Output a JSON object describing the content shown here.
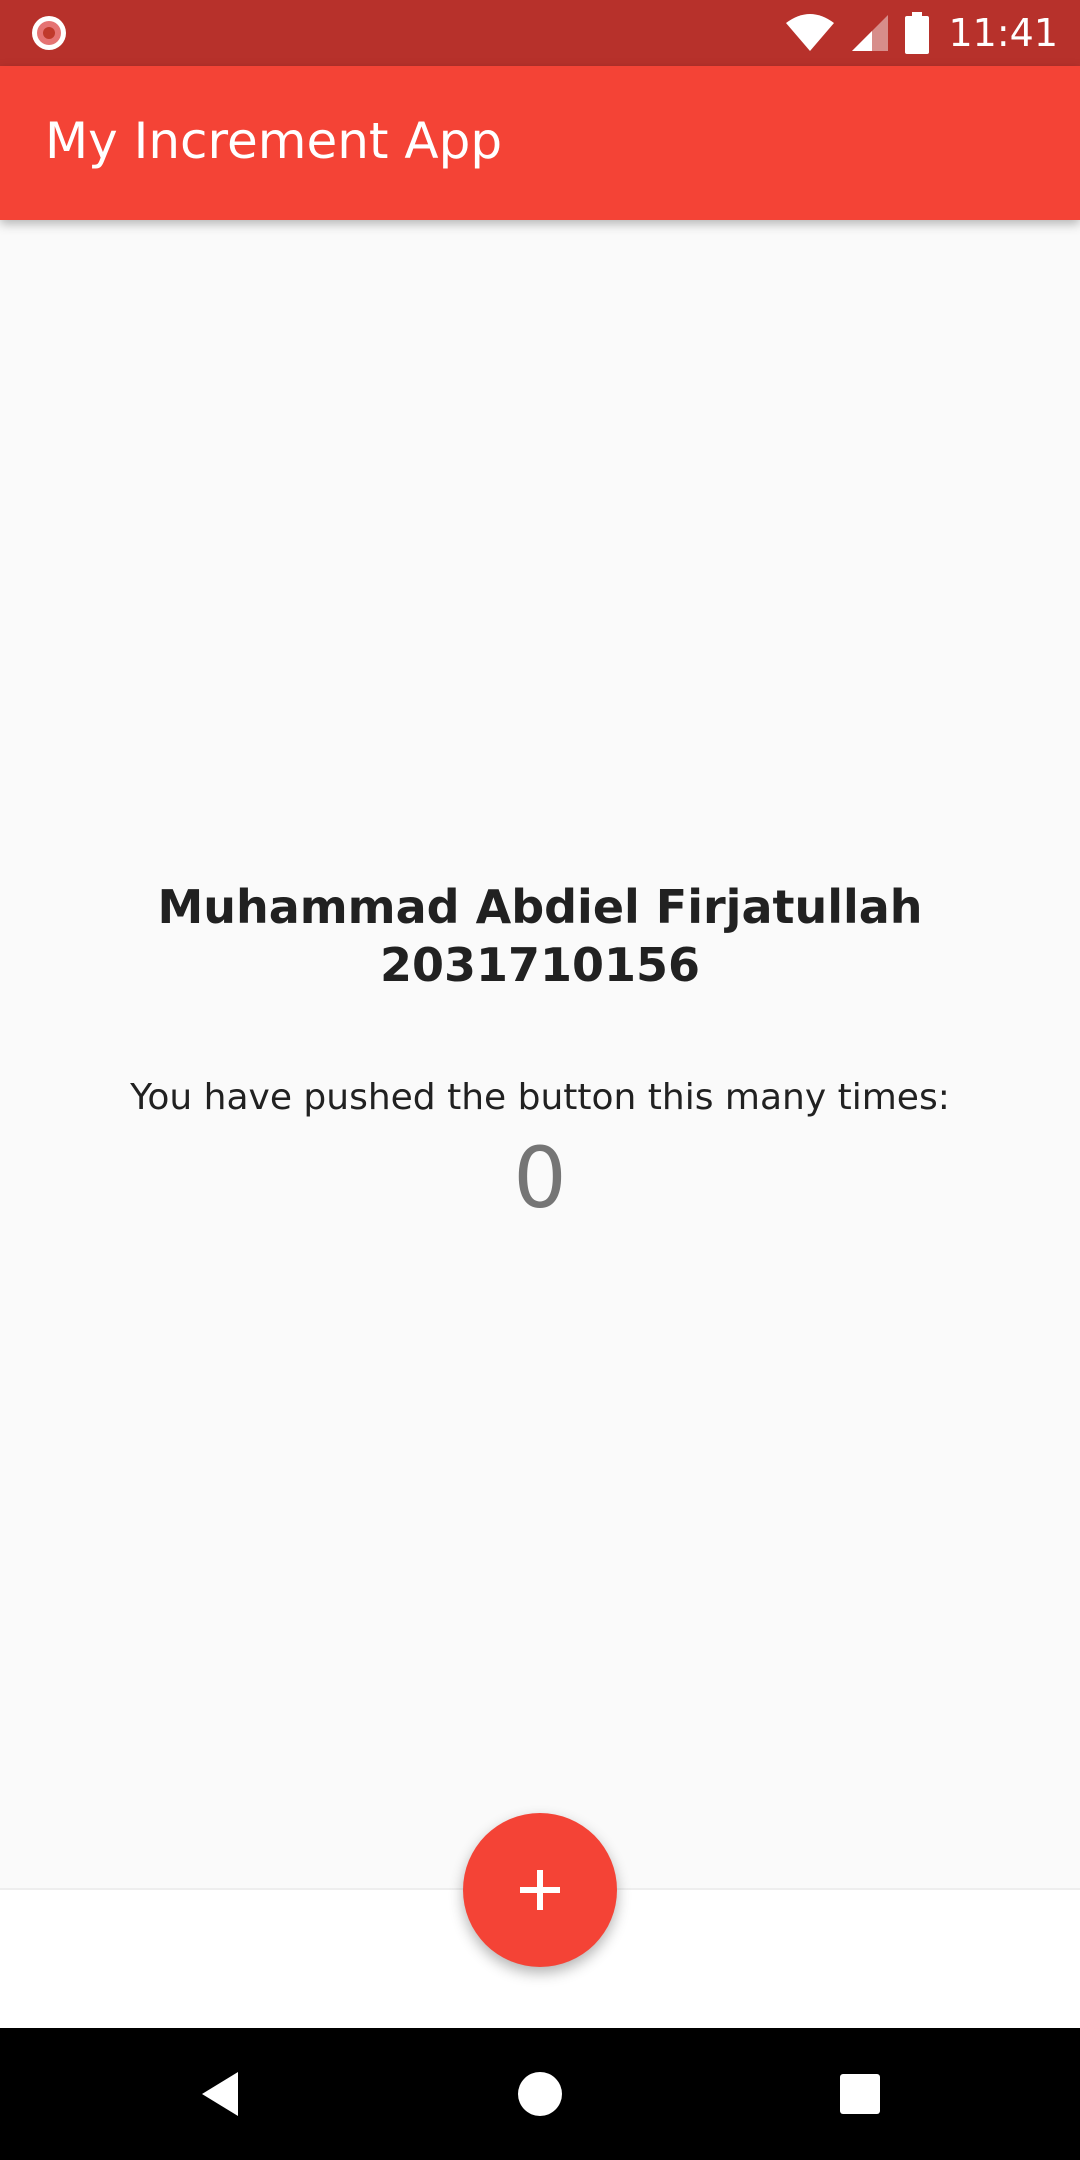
{
  "status_bar": {
    "time": "11:41",
    "icons": [
      "notification-dot-icon",
      "wifi-icon",
      "signal-icon",
      "battery-icon"
    ],
    "background_color": "#b7312b"
  },
  "app_bar": {
    "title": "My Increment App",
    "background_color": "#f44336"
  },
  "main": {
    "name": "Muhammad Abdiel Firjatullah",
    "student_id": "2031710156",
    "prompt": "You have pushed the button this many times:",
    "counter": "0"
  },
  "fab": {
    "icon": "plus-icon",
    "action": "increment",
    "color": "#f44336"
  },
  "nav_bar": {
    "buttons": [
      "back-icon",
      "home-icon",
      "recents-icon"
    ]
  }
}
